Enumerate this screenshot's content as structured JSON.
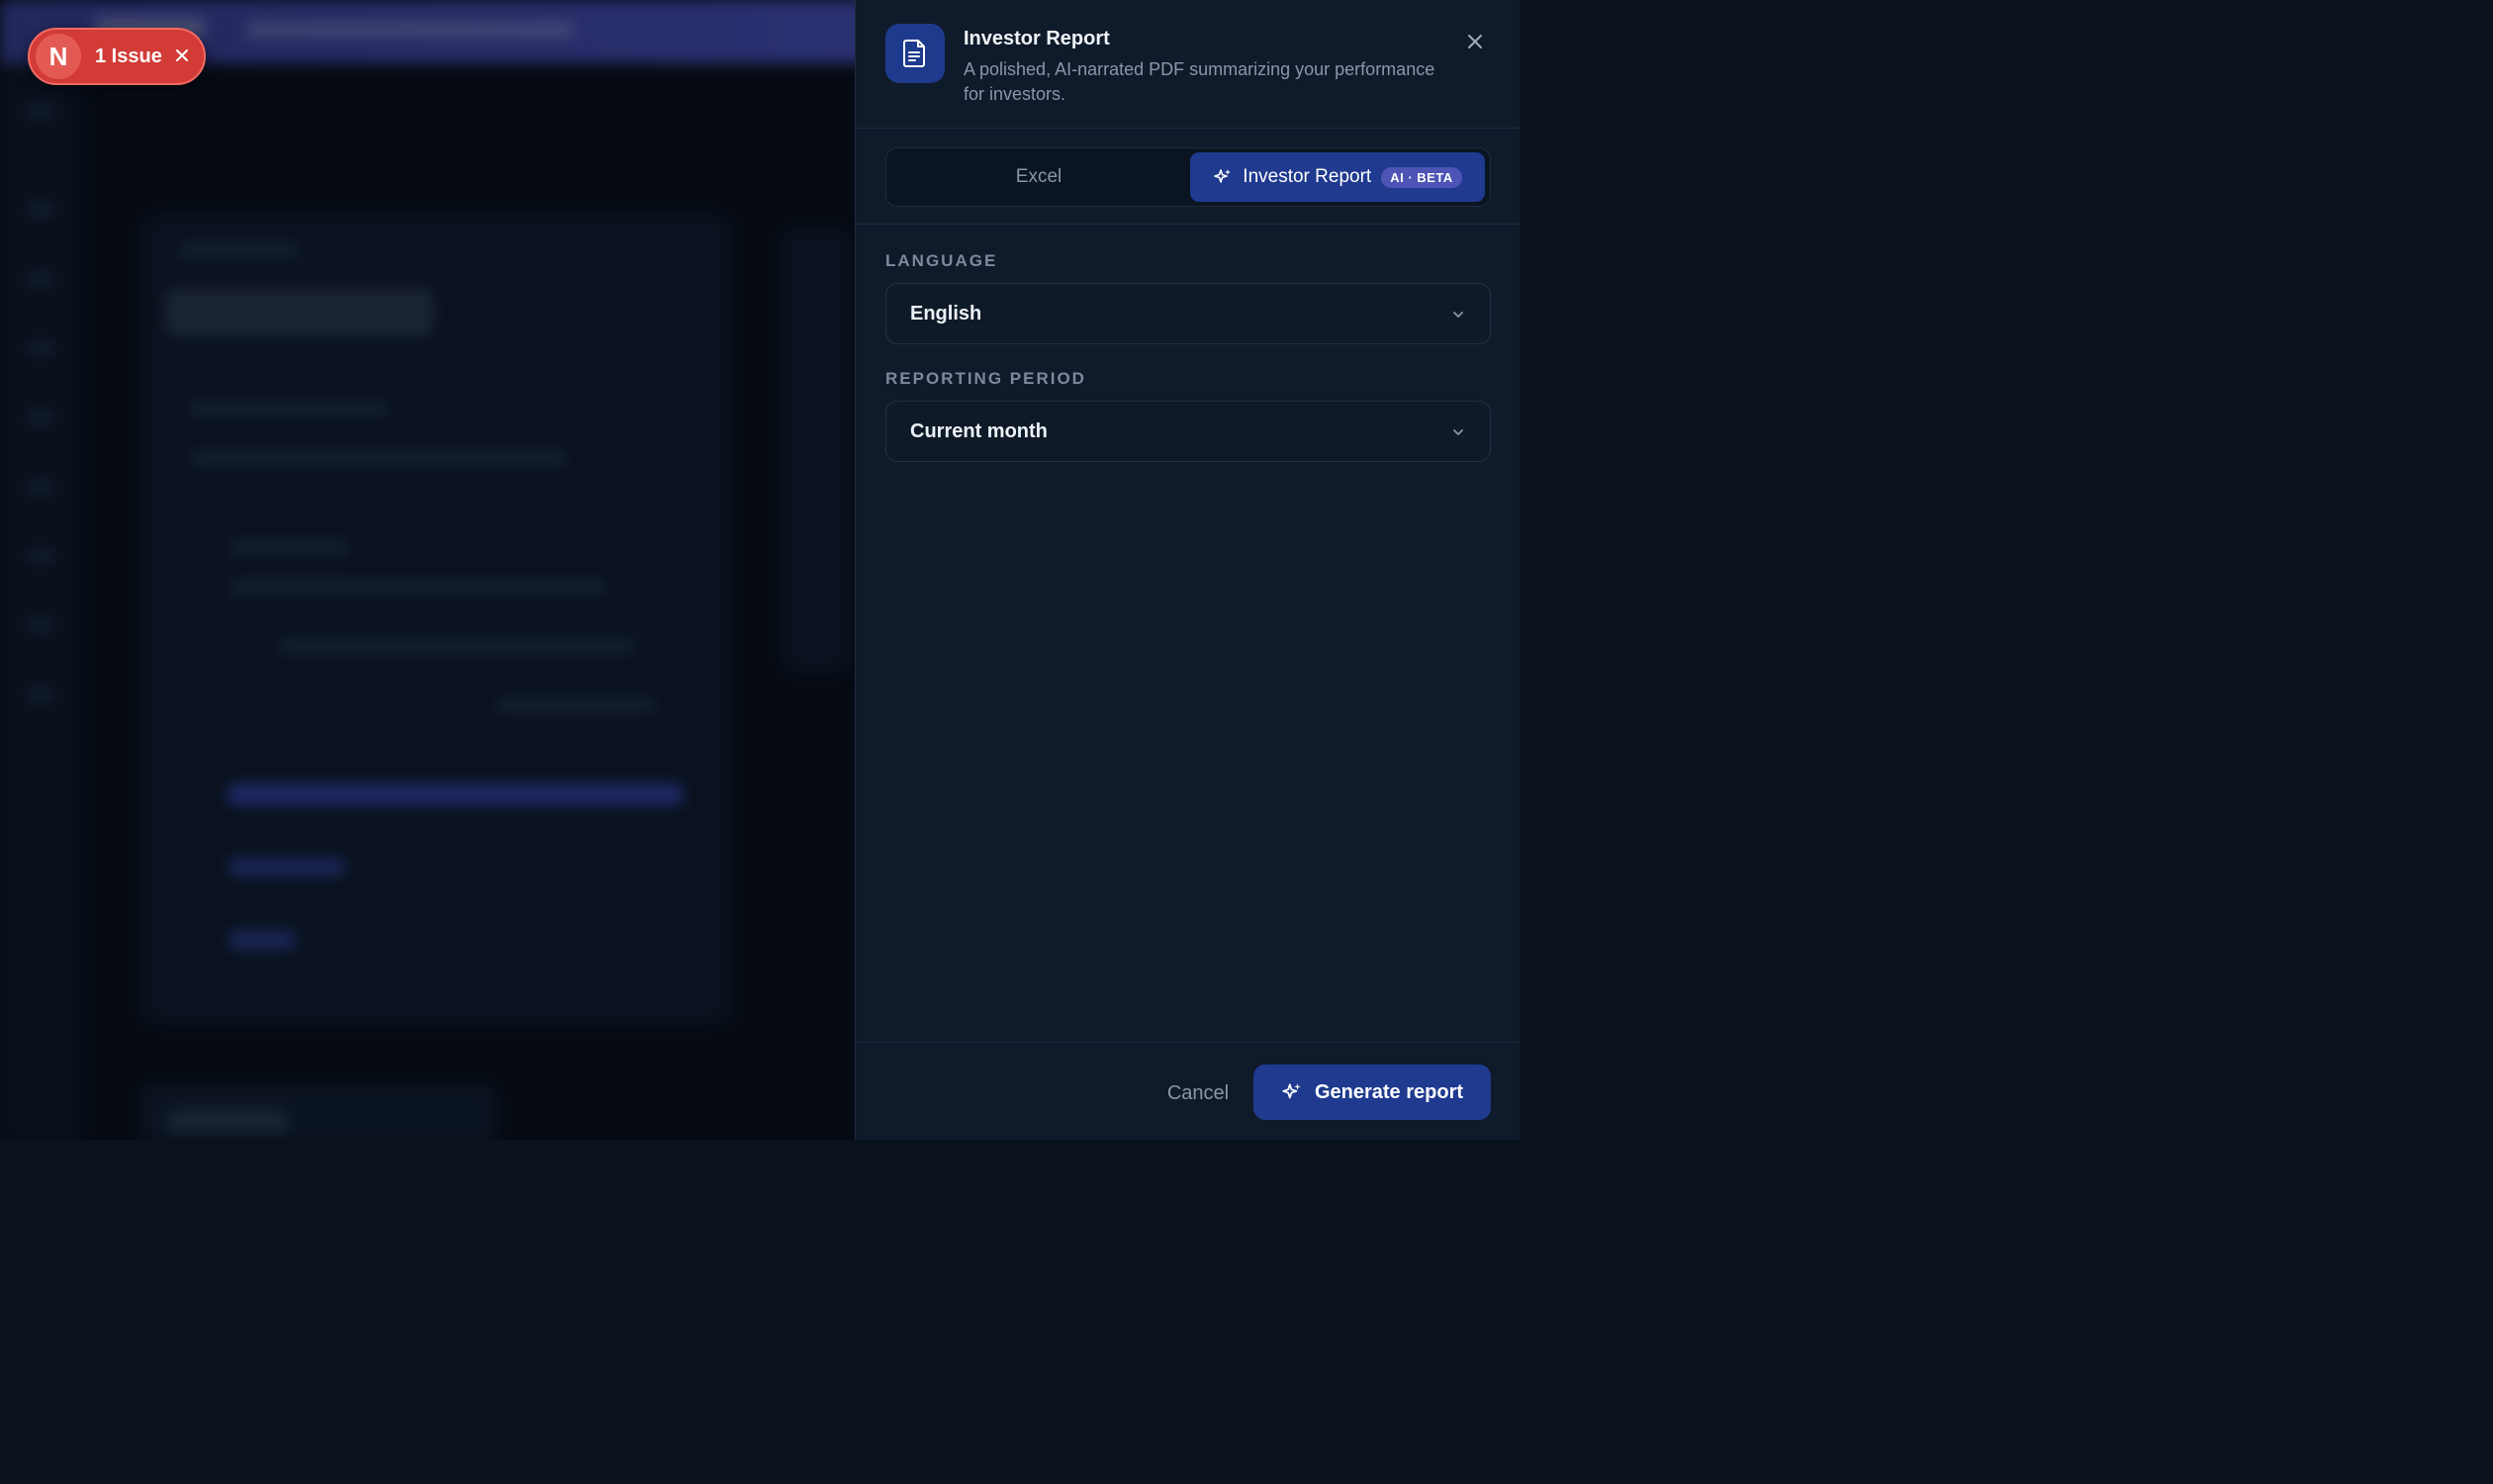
{
  "issue_pill": {
    "logo_letter": "N",
    "label": "1 Issue"
  },
  "panel": {
    "title": "Investor Report",
    "subtitle": "A polished, AI-narrated PDF summarizing your performance for investors.",
    "tabs": [
      {
        "label": "Excel",
        "selected": false
      },
      {
        "label": "Investor Report",
        "selected": true,
        "badge": "AI · BETA"
      }
    ],
    "language": {
      "label": "LANGUAGE",
      "value": "English"
    },
    "period": {
      "label": "REPORTING PERIOD",
      "value": "Current month"
    },
    "footer": {
      "cancel_label": "Cancel",
      "generate_label": "Generate report"
    }
  },
  "colors": {
    "accent": "#1f3a8f",
    "issue": "#d23b36",
    "panel_bg": "#0f1b2a",
    "badge": "#4d54b6"
  },
  "icons": {
    "header": "document-icon",
    "close": "close-icon",
    "tab": "sparkles-icon",
    "select": "chevron-down-icon",
    "generate": "sparkles-icon"
  }
}
